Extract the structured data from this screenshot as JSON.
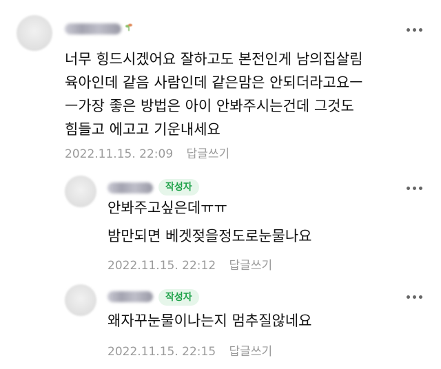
{
  "comments": [
    {
      "lines": [
        "너무 힝드시겠어요 잘하고도 본전인게 남의집살림",
        "육아인데 같음 사람인데 같은맘은 안되더라고요ㅡ",
        "ㅡ가장 좋은 방법은 아이 안봐주시는건데 그것도",
        "힘들고 에고고 기운내세요"
      ],
      "date": "2022.11.15. 22:09",
      "reply_label": "답글쓰기"
    },
    {
      "badge": "작성자",
      "lines": [
        "안봐주고싶은데ㅠㅠ",
        "밤만되면 베겟젖을정도로눈물나요"
      ],
      "date": "2022.11.15. 22:12",
      "reply_label": "답글쓰기"
    },
    {
      "badge": "작성자",
      "lines": [
        "왜자꾸눈물이나는지 멈추질않네요"
      ],
      "date": "2022.11.15. 22:15",
      "reply_label": "답글쓰기"
    }
  ],
  "icons": {
    "more": "more-vertical-dots-icon",
    "level": "sprout-icon"
  },
  "colors": {
    "author_badge_text": "#1fa24a",
    "author_badge_bg": "#e6f6ea",
    "meta_text": "#9b9b9b"
  }
}
